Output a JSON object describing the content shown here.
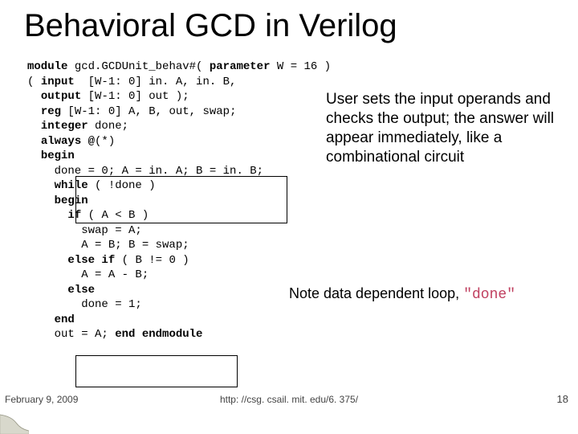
{
  "title": "Behavioral GCD in Verilog",
  "code": {
    "l01a": "module",
    "l01b": " gcd.GCDUnit_behav#( ",
    "l01c": "parameter",
    "l01d": " W = 16 )",
    "l02a": "( ",
    "l02b": "input",
    "l02c": "  [W-1: 0] in. A, in. B,",
    "l03a": "  ",
    "l03b": "output",
    "l03c": " [W-1: 0] out );",
    "l04a": "  ",
    "l04b": "reg",
    "l04c": " [W-1: 0] A, B, out, swap;",
    "l05a": "  ",
    "l05b": "integer",
    "l05c": " done;",
    "l06a": "  ",
    "l06b": "always @",
    "l06c": "(*)",
    "l07a": "  ",
    "l07b": "begin",
    "l08": "    done = 0; A = in. A; B = in. B;",
    "l09a": "    ",
    "l09b": "while",
    "l09c": " ( !done )",
    "l10a": "    ",
    "l10b": "begin",
    "l11a": "      ",
    "l11b": "if",
    "l11c": " ( A < B )",
    "l12": "        swap = A;",
    "l13": "        A = B; B = swap;",
    "l14a": "      ",
    "l14b": "else if",
    "l14c": " ( B != 0 )",
    "l15": "        A = A - B;",
    "l16a": "      ",
    "l16b": "else",
    "l17": "        done = 1;",
    "l18a": "    ",
    "l18b": "end",
    "l19a": "    out = A; ",
    "l19b": "end",
    "l19c": " ",
    "l19d": "endmodule"
  },
  "annot1": "User sets the input operands and checks the output; the answer will appear immediately, like a combinational circuit",
  "annot2a": "Note data dependent loop, ",
  "annot2b": "\"done\"",
  "footer": {
    "date": "February 9, 2009",
    "url": "http: //csg. csail. mit. edu/6. 375/",
    "page": "18"
  }
}
